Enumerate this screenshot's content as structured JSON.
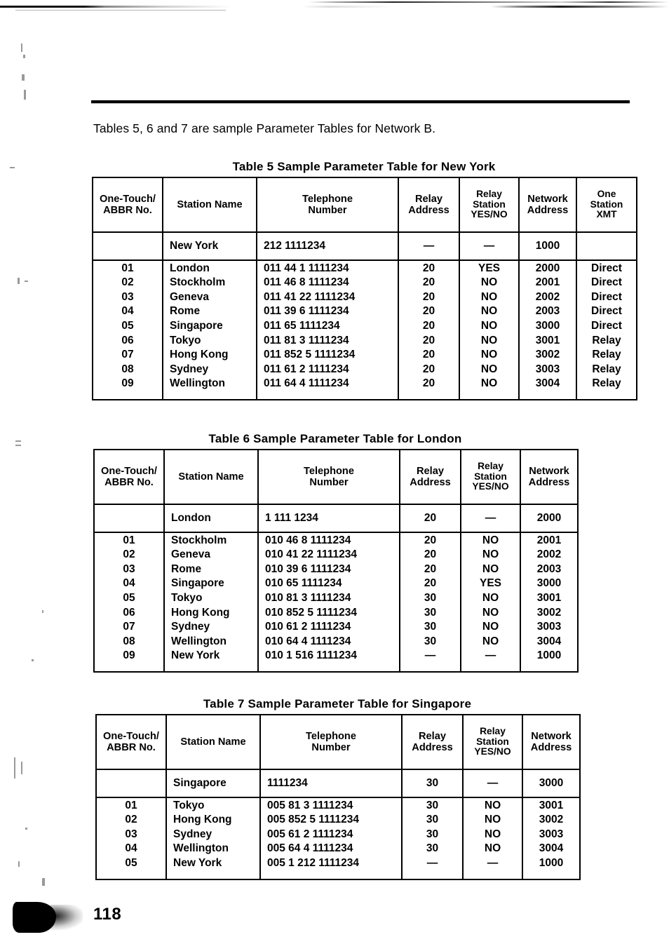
{
  "page": {
    "intro_text": "Tables 5, 6 and 7 are sample Parameter Tables for Network B.",
    "page_number": "118"
  },
  "columns": {
    "one_touch": "One-Touch/",
    "one_touch_2": "ABBR No.",
    "station_name": "Station Name",
    "telephone": "Telephone",
    "telephone_2": "Number",
    "relay_addr": "Relay",
    "relay_addr_2": "Address",
    "relay_station": "Relay",
    "relay_station_2": "Station",
    "relay_station_3": "YES/NO",
    "network_addr": "Network",
    "network_addr_2": "Address",
    "one_station": "One",
    "one_station_2": "Station",
    "one_station_3": "XMT"
  },
  "tables": [
    {
      "id": "table5",
      "title": "Table 5  Sample Parameter Table for New York",
      "has_xmt_column": true,
      "self_row": {
        "no": "",
        "station": "New York",
        "phone": "212 1111234",
        "relay_address": "—",
        "relay_station": "—",
        "network_address": "1000",
        "xmt": ""
      },
      "rows": [
        {
          "no": "01",
          "station": "London",
          "phone": "011 44 1 1111234",
          "relay_address": "20",
          "relay_station": "YES",
          "network_address": "2000",
          "xmt": "Direct"
        },
        {
          "no": "02",
          "station": "Stockholm",
          "phone": "011 46 8 1111234",
          "relay_address": "20",
          "relay_station": "NO",
          "network_address": "2001",
          "xmt": "Direct"
        },
        {
          "no": "03",
          "station": "Geneva",
          "phone": "011 41 22 1111234",
          "relay_address": "20",
          "relay_station": "NO",
          "network_address": "2002",
          "xmt": "Direct"
        },
        {
          "no": "04",
          "station": "Rome",
          "phone": "011 39 6 1111234",
          "relay_address": "20",
          "relay_station": "NO",
          "network_address": "2003",
          "xmt": "Direct"
        },
        {
          "no": "05",
          "station": "Singapore",
          "phone": "011 65 1111234",
          "relay_address": "20",
          "relay_station": "NO",
          "network_address": "3000",
          "xmt": "Direct"
        },
        {
          "no": "06",
          "station": "Tokyo",
          "phone": "011 81 3 1111234",
          "relay_address": "20",
          "relay_station": "NO",
          "network_address": "3001",
          "xmt": "Relay"
        },
        {
          "no": "07",
          "station": "Hong Kong",
          "phone": "011 852 5 1111234",
          "relay_address": "20",
          "relay_station": "NO",
          "network_address": "3002",
          "xmt": "Relay"
        },
        {
          "no": "08",
          "station": "Sydney",
          "phone": "011 61 2 1111234",
          "relay_address": "20",
          "relay_station": "NO",
          "network_address": "3003",
          "xmt": "Relay"
        },
        {
          "no": "09",
          "station": "Wellington",
          "phone": "011 64 4 1111234",
          "relay_address": "20",
          "relay_station": "NO",
          "network_address": "3004",
          "xmt": "Relay"
        }
      ]
    },
    {
      "id": "table6",
      "title": "Table 6  Sample Parameter Table for London",
      "has_xmt_column": false,
      "self_row": {
        "no": "",
        "station": "London",
        "phone": "1 111 1234",
        "relay_address": "20",
        "relay_station": "—",
        "network_address": "2000"
      },
      "rows": [
        {
          "no": "01",
          "station": "Stockholm",
          "phone": "010 46 8 1111234",
          "relay_address": "20",
          "relay_station": "NO",
          "network_address": "2001"
        },
        {
          "no": "02",
          "station": "Geneva",
          "phone": "010 41 22 1111234",
          "relay_address": "20",
          "relay_station": "NO",
          "network_address": "2002"
        },
        {
          "no": "03",
          "station": "Rome",
          "phone": "010 39 6 1111234",
          "relay_address": "20",
          "relay_station": "NO",
          "network_address": "2003"
        },
        {
          "no": "04",
          "station": "Singapore",
          "phone": "010 65 1111234",
          "relay_address": "20",
          "relay_station": "YES",
          "network_address": "3000"
        },
        {
          "no": "05",
          "station": "Tokyo",
          "phone": "010 81 3 1111234",
          "relay_address": "30",
          "relay_station": "NO",
          "network_address": "3001"
        },
        {
          "no": "06",
          "station": "Hong Kong",
          "phone": "010 852 5 1111234",
          "relay_address": "30",
          "relay_station": "NO",
          "network_address": "3002"
        },
        {
          "no": "07",
          "station": "Sydney",
          "phone": "010 61 2 1111234",
          "relay_address": "30",
          "relay_station": "NO",
          "network_address": "3003"
        },
        {
          "no": "08",
          "station": "Wellington",
          "phone": "010 64 4 1111234",
          "relay_address": "30",
          "relay_station": "NO",
          "network_address": "3004"
        },
        {
          "no": "09",
          "station": "New York",
          "phone": "010 1 516 1111234",
          "relay_address": "—",
          "relay_station": "—",
          "network_address": "1000"
        }
      ]
    },
    {
      "id": "table7",
      "title": "Table 7  Sample Parameter Table for Singapore",
      "has_xmt_column": false,
      "self_row": {
        "no": "",
        "station": "Singapore",
        "phone": "1111234",
        "relay_address": "30",
        "relay_station": "—",
        "network_address": "3000"
      },
      "rows": [
        {
          "no": "01",
          "station": "Tokyo",
          "phone": "005 81 3 1111234",
          "relay_address": "30",
          "relay_station": "NO",
          "network_address": "3001"
        },
        {
          "no": "02",
          "station": "Hong Kong",
          "phone": "005 852 5 1111234",
          "relay_address": "30",
          "relay_station": "NO",
          "network_address": "3002"
        },
        {
          "no": "03",
          "station": "Sydney",
          "phone": "005 61 2 1111234",
          "relay_address": "30",
          "relay_station": "NO",
          "network_address": "3003"
        },
        {
          "no": "04",
          "station": "Wellington",
          "phone": "005 64 4 1111234",
          "relay_address": "30",
          "relay_station": "NO",
          "network_address": "3004"
        },
        {
          "no": "05",
          "station": "New York",
          "phone": "005 1 212 1111234",
          "relay_address": "—",
          "relay_station": "—",
          "network_address": "1000"
        }
      ]
    }
  ]
}
